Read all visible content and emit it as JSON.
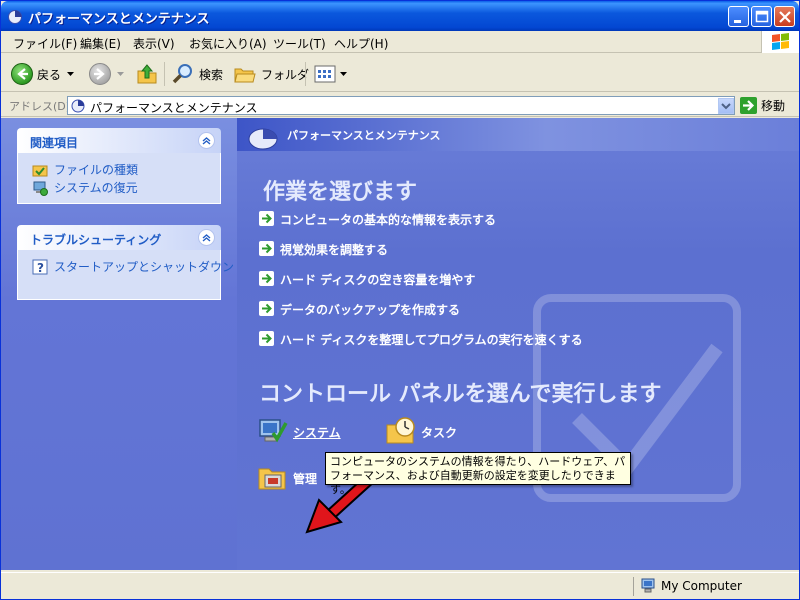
{
  "window": {
    "title": "パフォーマンスとメンテナンス"
  },
  "menu": [
    "ファイル(F)",
    "編集(E)",
    "表示(V)",
    "お気に入り(A)",
    "ツール(T)",
    "ヘルプ(H)"
  ],
  "toolbar": {
    "back_label": "戻る",
    "search_label": "検索",
    "folders_label": "フォルダ"
  },
  "address": {
    "label": "アドレス(D)",
    "value": "パフォーマンスとメンテナンス",
    "go_label": "移動"
  },
  "sidebar": {
    "related": {
      "title": "関連項目",
      "items": [
        "ファイルの種類",
        "システムの復元"
      ]
    },
    "troubleshoot": {
      "title": "トラブルシューティング",
      "items": [
        "スタートアップとシャットダウン"
      ]
    }
  },
  "main": {
    "banner_title": "パフォーマンスとメンテナンス",
    "pick_task_heading": "作業を選びます",
    "tasks": [
      "コンピュータの基本的な情報を表示する",
      "視覚効果を調整する",
      "ハード ディスクの空き容量を増やす",
      "データのバックアップを作成する",
      "ハード ディスクを整理してプログラムの実行を速くする"
    ],
    "pick_cp_heading": "コントロール パネルを選んで実行します",
    "cp_items": {
      "system": "システム",
      "tasks": "タスク",
      "admin": "管理"
    },
    "tooltip": "コンピュータのシステムの情報を得たり、ハードウェア、パフォーマンス、および自動更新の設定を変更したりできます。"
  },
  "status": {
    "zone": "My Computer"
  }
}
